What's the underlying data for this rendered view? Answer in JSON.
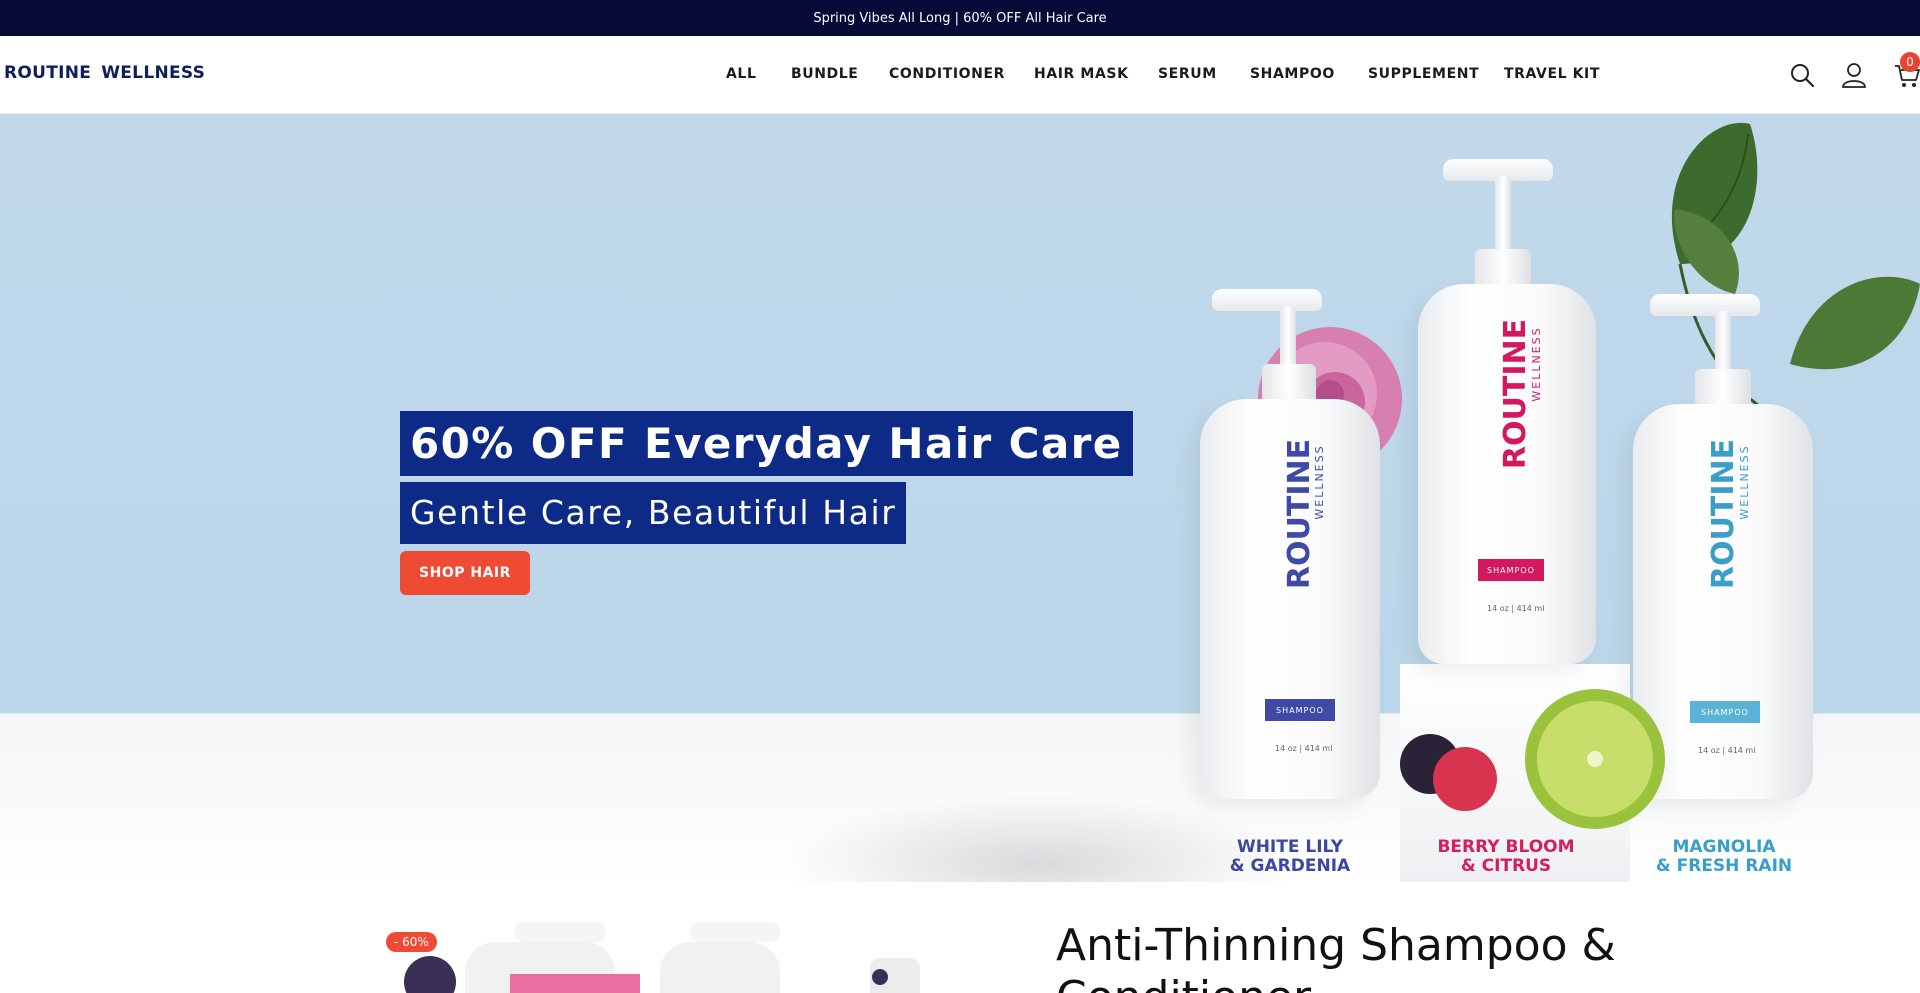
{
  "announcement": {
    "text": "Spring Vibes All Long | 60% OFF All Hair Care"
  },
  "header": {
    "logo_word1": "ROUTINE",
    "logo_word2": "WELLNESS",
    "nav": [
      {
        "label": "ALL"
      },
      {
        "label": "BUNDLE"
      },
      {
        "label": "CONDITIONER"
      },
      {
        "label": "HAIR MASK"
      },
      {
        "label": "SERUM"
      },
      {
        "label": "SHAMPOO"
      },
      {
        "label": "SUPPLEMENT"
      },
      {
        "label": "TRAVEL KIT"
      }
    ],
    "icons": {
      "search": "search-icon",
      "account": "user-icon",
      "cart": "cart-icon"
    },
    "cart_count": "0"
  },
  "hero": {
    "title": "60% OFF Everyday Hair Care",
    "subtitle": "Gentle Care, Beautiful Hair",
    "cta": "SHOP HAIR",
    "bottles": [
      {
        "brand": "ROUTINE",
        "sub": "WELLNESS",
        "tag": "SHAMPOO",
        "size": "14 oz | 414 ml",
        "color": "#3f4aa6"
      },
      {
        "brand": "ROUTINE",
        "sub": "WELLNESS",
        "tag": "SHAMPOO",
        "size": "14 oz | 414 ml",
        "color": "#d4185f"
      },
      {
        "brand": "ROUTINE",
        "sub": "WELLNESS",
        "tag": "SHAMPOO",
        "size": "14 oz | 414 ml",
        "color": "#3b9ec8"
      }
    ],
    "scents": [
      {
        "line1": "WHITE LILY",
        "line2": "& GARDENIA",
        "color": "#3c48a0"
      },
      {
        "line1": "BERRY BLOOM",
        "line2": "& CITRUS",
        "color": "#d41e5e"
      },
      {
        "line1": "MAGNOLIA",
        "line2": "& FRESH RAIN",
        "color": "#3a9ecb"
      }
    ]
  },
  "product": {
    "discount": "- 60%",
    "title": "Anti-Thinning Shampoo & Conditioner"
  },
  "colors": {
    "announce_bg": "#050b36",
    "brand_navy": "#0c2a86",
    "cta": "#ef4a33",
    "hero_sky": "#bcd6e9"
  }
}
